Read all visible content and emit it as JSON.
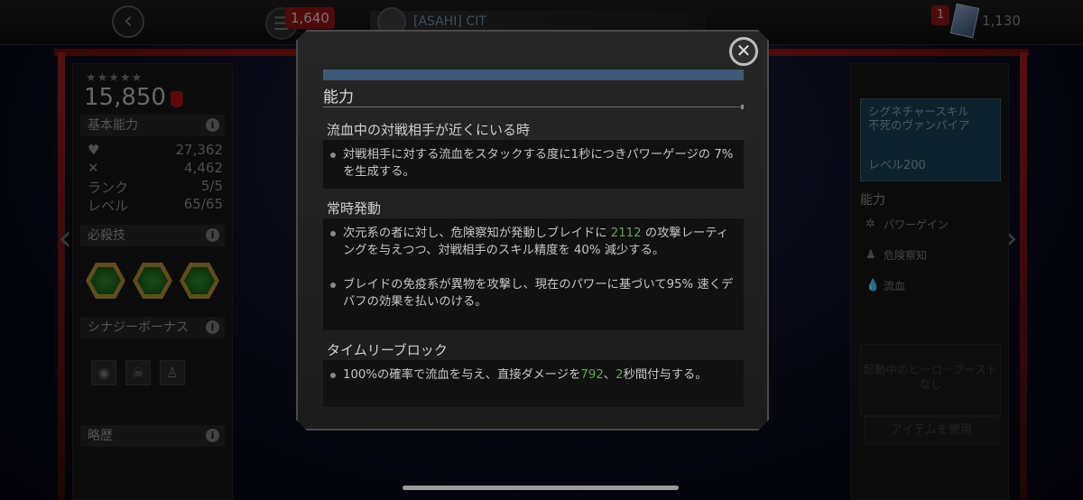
{
  "topbar": {
    "currency_value": "1,640",
    "alliance_name": "[ASAHI] CIT",
    "notification_count": "1",
    "right_value": "1,130"
  },
  "hero": {
    "stars": "★★★★★",
    "rating": "15,850",
    "base_header": "基本能力",
    "stats": [
      {
        "label": "",
        "value": "27,362"
      },
      {
        "label": "",
        "value": "4,462"
      },
      {
        "label": "ランク",
        "value": "5/5"
      },
      {
        "label": "レベル",
        "value": "65/65"
      }
    ],
    "special_header": "必殺技",
    "synergy_header": "シナジーボーナス",
    "bio_header": "略歴"
  },
  "right_panel": {
    "signature_title": "シグネチャースキル",
    "signature_name": "不死のヴァンパイア",
    "signature_level": "レベル200",
    "abilities_header": "能力",
    "abilities": [
      "パワーゲイン",
      "危険察知",
      "流血"
    ],
    "boost_text": "起動中のヒーローブーストなし",
    "use_item_label": "アイテムを使用"
  },
  "modal": {
    "title": "能力",
    "close_icon": "close-icon",
    "sections": [
      {
        "title": "流血中の対戦相手が近くにいる時",
        "items": [
          {
            "pre": "対戦相手に対する流血をスタックする度に1秒につきパワーゲージの 7% を生成する。"
          }
        ]
      },
      {
        "title": "常時発動",
        "items": [
          {
            "pre": "次元系の者に対し、危険察知が発動しブレイドに ",
            "num": "2112",
            "post": " の攻撃レーティングを与えつつ、対戦相手のスキル精度を 40% 減少する。"
          },
          {
            "pre": "ブレイドの免疫系が異物を攻撃し、現在のパワーに基づいて95% 速くデバフの効果を払いのける。"
          }
        ]
      },
      {
        "title": "タイムリーブロック",
        "items": [
          {
            "pre": "100%の確率で流血を与え、直接ダメージを",
            "num": "792",
            "mid": "、",
            "num2": "2",
            "post": "秒間付与する。"
          }
        ]
      }
    ]
  },
  "colors": {
    "accent_blue": "#3b5979",
    "highlight_green": "#5aa84a",
    "frame_red": "#b21d1d",
    "signature_bg": "#1b3f52"
  }
}
